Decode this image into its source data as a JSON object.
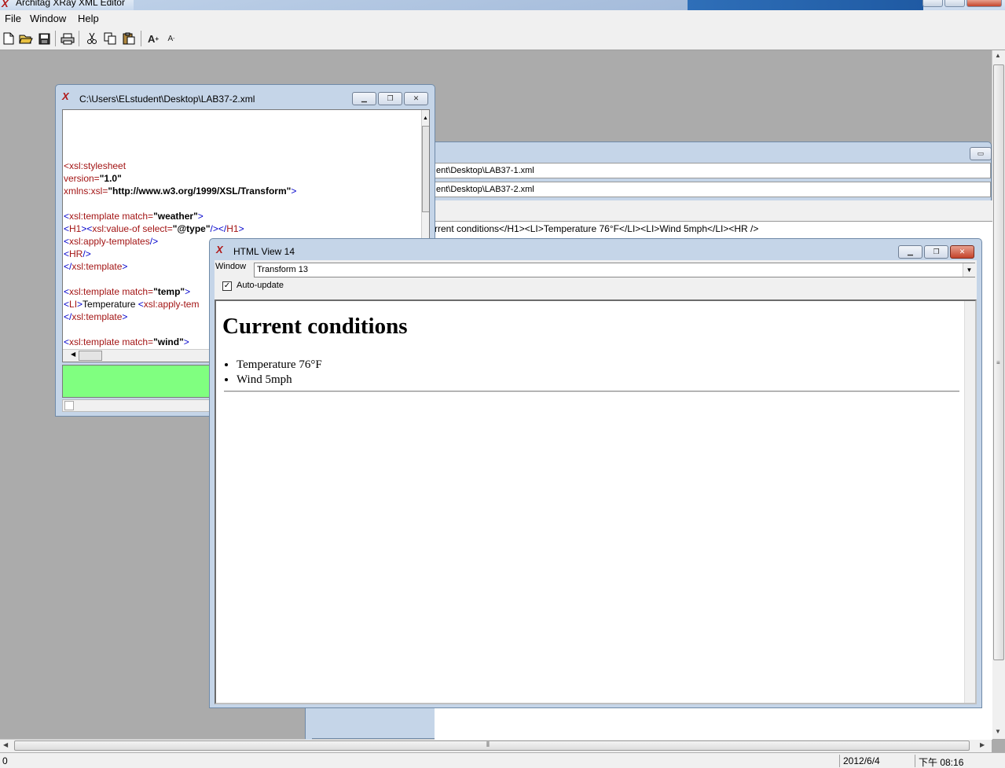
{
  "app": {
    "title": "Architag XRay XML Editor",
    "menu": [
      "File",
      "Window",
      "Help"
    ]
  },
  "toolbar": {
    "icons": [
      "new-file-icon",
      "open-folder-icon",
      "save-icon",
      "print-icon",
      "cut-icon",
      "copy-icon",
      "paste-icon",
      "font-bigger-icon",
      "font-smaller-icon"
    ]
  },
  "xml_window": {
    "title": "C:\\Users\\ELstudent\\Desktop\\LAB37-2.xml",
    "code": [
      {
        "parts": [
          [
            "r",
            "<"
          ],
          [
            "r",
            "xsl:stylesheet"
          ]
        ]
      },
      {
        "parts": [
          [
            "r",
            "version="
          ],
          [
            "b",
            "\"1.0\""
          ]
        ]
      },
      {
        "parts": [
          [
            "r",
            "xmlns:xsl="
          ],
          [
            "b",
            "\"http://www.w3.org/1999/XSL/Transform\""
          ],
          [
            "u",
            ">"
          ]
        ]
      },
      {
        "parts": []
      },
      {
        "parts": [
          [
            "u",
            "<"
          ],
          [
            "r",
            "xsl:template match="
          ],
          [
            "b",
            "\"weather\""
          ],
          [
            "u",
            ">"
          ]
        ]
      },
      {
        "parts": [
          [
            "u",
            "<"
          ],
          [
            "r",
            "H1"
          ],
          [
            "u",
            "><"
          ],
          [
            "r",
            "xsl:value-of select="
          ],
          [
            "b",
            "\"@type\""
          ],
          [
            "u",
            "/></"
          ],
          [
            "r",
            "H1"
          ],
          [
            "u",
            ">"
          ]
        ]
      },
      {
        "parts": [
          [
            "u",
            "<"
          ],
          [
            "r",
            "xsl:apply-templates"
          ],
          [
            "u",
            "/>"
          ]
        ]
      },
      {
        "parts": [
          [
            "u",
            "<"
          ],
          [
            "r",
            "HR"
          ],
          [
            "u",
            "/>"
          ]
        ]
      },
      {
        "parts": [
          [
            "u",
            "</"
          ],
          [
            "r",
            "xsl:template"
          ],
          [
            "u",
            ">"
          ]
        ]
      },
      {
        "parts": []
      },
      {
        "parts": [
          [
            "u",
            "<"
          ],
          [
            "r",
            "xsl:template match="
          ],
          [
            "b",
            "\"temp\""
          ],
          [
            "u",
            ">"
          ]
        ]
      },
      {
        "parts": [
          [
            "u",
            "<"
          ],
          [
            "r",
            "LI"
          ],
          [
            "u",
            ">"
          ],
          [
            "k",
            "Temperature "
          ],
          [
            "u",
            "<"
          ],
          [
            "r",
            "xsl:apply-tem"
          ]
        ]
      },
      {
        "parts": [
          [
            "u",
            "</"
          ],
          [
            "r",
            "xsl:template"
          ],
          [
            "u",
            ">"
          ]
        ]
      },
      {
        "parts": []
      },
      {
        "parts": [
          [
            "u",
            "<"
          ],
          [
            "r",
            "xsl:template match="
          ],
          [
            "b",
            "\"wind\""
          ],
          [
            "u",
            ">"
          ]
        ]
      }
    ]
  },
  "transform_window": {
    "file1": "ent\\Desktop\\LAB37-1.xml",
    "file2": "ent\\Desktop\\LAB37-2.xml",
    "output": "rrent conditions</H1><LI>Temperature 76°F</LI><LI>Wind 5mph</LI><HR />"
  },
  "html_view": {
    "title": "HTML View 14",
    "window_label": "Window",
    "window_select": "Transform 13",
    "auto_update_label": "Auto-update",
    "auto_update_checked": true,
    "heading": "Current conditions",
    "items": [
      "Temperature 76°F",
      "Wind 5mph"
    ]
  },
  "status": {
    "left": "0",
    "date": "2012/6/4",
    "time": "下午 08:16"
  },
  "colors": {
    "mdi_background": "#ababab",
    "status_green": "#80ff80",
    "tag_red": "#a31515",
    "punct_blue": "#0000cc"
  }
}
